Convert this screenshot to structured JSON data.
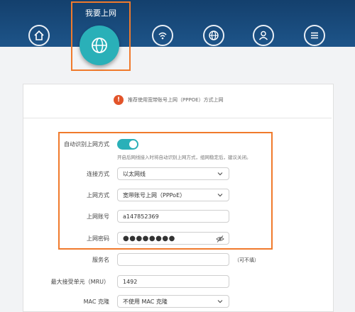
{
  "nav": {
    "active_title": "我要上网",
    "items": [
      {
        "icon": "home-icon"
      },
      {
        "icon": "globe-icon"
      },
      {
        "icon": "wifi-icon"
      },
      {
        "icon": "network-icon"
      },
      {
        "icon": "user-icon"
      },
      {
        "icon": "menu-icon"
      }
    ]
  },
  "notice": {
    "icon_text": "!",
    "text": "推荐使用宽带账号上网（PPPOE）方式上网"
  },
  "form": {
    "auto_detect_label": "自动识别上网方式",
    "auto_detect_hint": "开启后网线接入时将自动识别上网方式，组网稳定后，建议关闭。",
    "connection_label": "连接方式",
    "connection_value": "以太网线",
    "mode_label": "上网方式",
    "mode_value": "宽带账号上网（PPPoE）",
    "account_label": "上网账号",
    "account_value": "a147852369",
    "password_label": "上网密码",
    "password_value": "●●●●●●●●",
    "service_label": "服务名",
    "service_value": "",
    "service_note": "（可不填）",
    "mru_label": "最大接受单元（MRU）",
    "mru_value": "1492",
    "mac_label": "MAC 克隆",
    "mac_value": "不使用 MAC 克隆"
  },
  "colors": {
    "accent": "#2ab0b8",
    "highlight": "#f07a2c",
    "header": "#1a4a7c"
  }
}
